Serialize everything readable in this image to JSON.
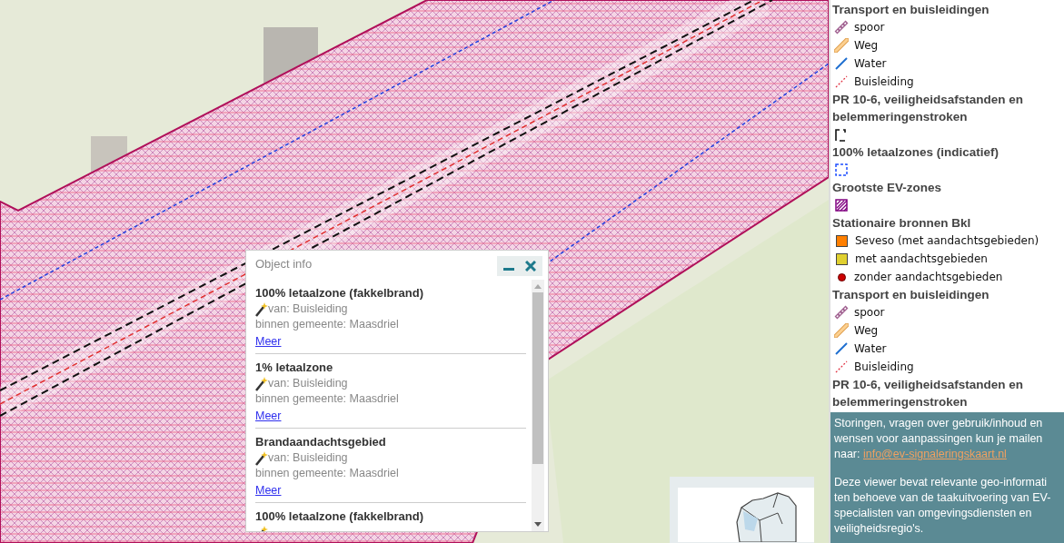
{
  "popup": {
    "title": "Object info",
    "features": [
      {
        "title": "100% letaalzone (fakkelbrand)",
        "source": "van: Buisleiding",
        "municipality": "binnen gemeente: Maasdriel",
        "link": "Meer"
      },
      {
        "title": "1% letaalzone",
        "source": "van: Buisleiding",
        "municipality": "binnen gemeente: Maasdriel",
        "link": "Meer"
      },
      {
        "title": "Brandaandachtsgebied",
        "source": "van: Buisleiding",
        "municipality": "binnen gemeente: Maasdriel",
        "link": "Meer"
      },
      {
        "title": "100% letaalzone (fakkelbrand)"
      }
    ]
  },
  "legend": {
    "sections": [
      {
        "title": "Transport en buisleidingen",
        "items": [
          {
            "kind": "rail",
            "label": "spoor"
          },
          {
            "kind": "road",
            "label": "Weg"
          },
          {
            "kind": "water",
            "label": "Water"
          },
          {
            "kind": "pipe",
            "label": "Buisleiding"
          }
        ]
      },
      {
        "title": "PR 10-6, veiligheidsafstanden en belemmeringenstroken",
        "items": [
          {
            "kind": "bracket"
          }
        ]
      },
      {
        "title": "100% letaalzones (indicatief)",
        "items": [
          {
            "kind": "dashed-box"
          }
        ]
      },
      {
        "title": "Grootste EV-zones",
        "items": [
          {
            "kind": "hatch"
          }
        ]
      },
      {
        "title": "Stationaire bronnen Bkl",
        "items": [
          {
            "kind": "square",
            "label": "Seveso (met aandachtsgebieden)",
            "color": "#ff7f00"
          },
          {
            "kind": "square",
            "label": "met aandachtsgebieden",
            "color": "#e0d030"
          },
          {
            "kind": "dot",
            "label": "zonder aandachtsgebieden",
            "color": "#cc0000"
          }
        ]
      },
      {
        "title": "Transport en buisleidingen",
        "items": [
          {
            "kind": "rail",
            "label": "spoor"
          },
          {
            "kind": "road",
            "label": "Weg"
          },
          {
            "kind": "water",
            "label": "Water"
          },
          {
            "kind": "pipe",
            "label": "Buisleiding"
          }
        ]
      },
      {
        "title": "PR 10-6, veiligheidsafstanden en belemmeringenstroken"
      }
    ]
  },
  "info": {
    "paragraphs": [
      {
        "lines": [
          "Storingen, vragen over gebruik/inhoud en",
          "wensen voor aanpassingen kun je mailen",
          "naar: "
        ],
        "link": "info@ev-signaleringskaart.nl"
      },
      {
        "lines": [
          "Deze viewer bevat relevante geo-informati",
          "ten behoeve van de taakuitvoering van EV-",
          "specialisten van omgevingsdiensten en",
          "veiligheidsregio's."
        ]
      }
    ]
  }
}
